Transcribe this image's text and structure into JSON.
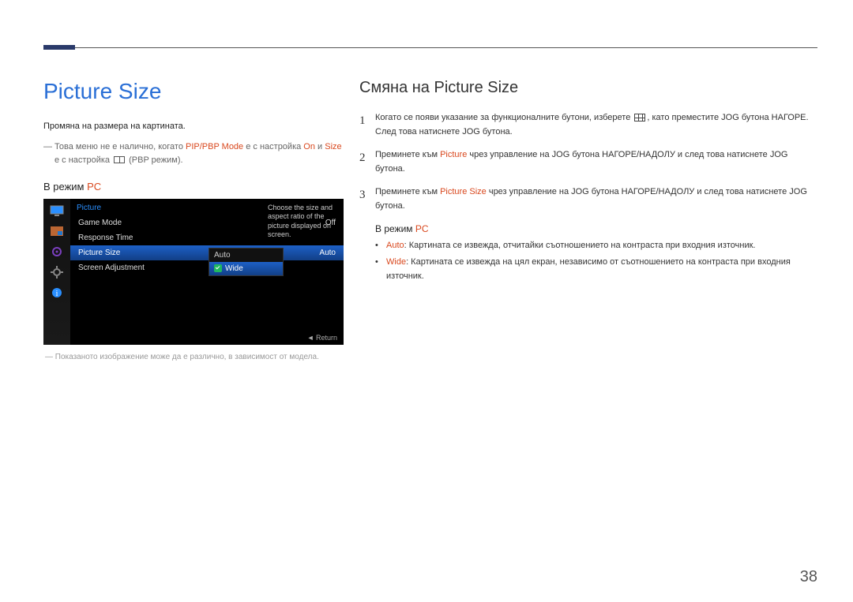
{
  "page_number": "38",
  "left": {
    "title": "Picture Size",
    "desc": "Промяна на размера на картината.",
    "note_pre": "― Това меню не е налично, когато ",
    "note_kw1": "PIP/PBP Mode",
    "note_mid1": " е с настройка ",
    "note_kw2": "On",
    "note_mid2": " и ",
    "note_kw3": "Size",
    "note_mid3": " е с настройка ",
    "note_post": " (PBP режим).",
    "sub_label": "В режим ",
    "sub_kw": "PC",
    "osd_note": "― Показаното изображение може да е различно, в зависимост от модела."
  },
  "osd": {
    "title": "Picture",
    "rows": {
      "game_mode": "Game Mode",
      "game_mode_val": "Off",
      "response_time": "Response Time",
      "picture_size": "Picture Size",
      "picture_size_val": "Auto",
      "screen_adjustment": "Screen Adjustment"
    },
    "sub": {
      "auto": "Auto",
      "wide": "Wide"
    },
    "help": "Choose the size and aspect ratio of the picture displayed on screen.",
    "return": "◄  Return"
  },
  "right": {
    "title": "Смяна на Picture Size",
    "step1_a": "Когато се появи указание за функционалните бутони, изберете ",
    "step1_b": ", като преместите JOG бутона НАГОРЕ. След това натиснете JOG бутона.",
    "step2_a": "Преминете към ",
    "step2_kw": "Picture",
    "step2_b": " чрез управление на JOG бутона НАГОРЕ/НАДОЛУ и след това натиснете JOG бутона.",
    "step3_a": "Преминете към ",
    "step3_kw": "Picture Size",
    "step3_b": " чрез управление на JOG бутона НАГОРЕ/НАДОЛУ и след това натиснете JOG бутона.",
    "sub_label": "В режим ",
    "sub_kw": "PC",
    "bullet1_kw": "Auto",
    "bullet1_txt": ": Картината се извежда, отчитайки съотношението на контраста при входния източник.",
    "bullet2_kw": "Wide",
    "bullet2_txt": ": Картината се извежда на цял екран, независимо от съотношението на контраста при входния източник."
  }
}
